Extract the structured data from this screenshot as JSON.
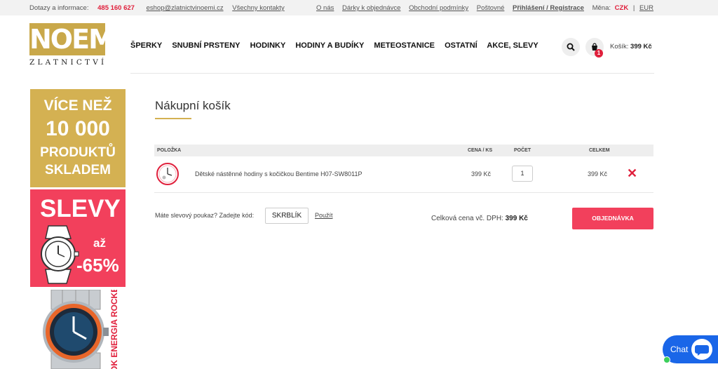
{
  "topbar": {
    "contact_label": "Dotazy a informace:",
    "phone": "485 160 627",
    "email": "eshop@zlatnictvinoemi.cz",
    "contacts_link": "Všechny kontakty",
    "links": [
      "O nás",
      "Dárky k objednávce",
      "Obchodní podmínky",
      "Poštovné"
    ],
    "login": "Přihlášení / Registrace",
    "currency_label": "Měna:",
    "currency_active": "CZK",
    "currency_sep": "|",
    "currency_other": "EUR"
  },
  "logo": {
    "mark": "NOEMI",
    "subtitle": "ZLATNICTVÍ"
  },
  "nav": [
    "ŠPERKY",
    "SNUBNÍ PRSTENY",
    "HODINKY",
    "HODINY A BUDÍKY",
    "METEOSTANICE",
    "OSTATNÍ",
    "AKCE, SLEVY"
  ],
  "cart": {
    "badge": "1",
    "label": "Košík:",
    "amount": "399 Kč"
  },
  "banners": {
    "b1": {
      "line1": "VÍCE NEŽ",
      "line2": "10 000",
      "line3": "PRODUKTŮ",
      "line4": "SKLADEM"
    },
    "b2": {
      "title": "SLEVY",
      "az": "až",
      "pct": "-65%"
    },
    "b3": {
      "vertical": "OK ENERGIA ROCKET"
    }
  },
  "page": {
    "title": "Nákupní košík"
  },
  "table": {
    "headers": {
      "item": "POLOŽKA",
      "price": "CENA / KS",
      "qty": "POČET",
      "total": "CELKEM"
    },
    "rows": [
      {
        "name": "Dětské nástěnné hodiny s kočičkou Bentime H07-SW8011P",
        "price": "399 Kč",
        "qty": "1",
        "total": "399 Kč",
        "remove": "✕"
      }
    ]
  },
  "coupon": {
    "label": "Máte slevový poukaz? Zadejte kód:",
    "value": "SKRBLÍK",
    "apply": "Použít"
  },
  "summary": {
    "label": "Celková cena vč. DPH:",
    "amount": "399 Kč"
  },
  "order_button": "OBJEDNÁVKA",
  "chat": {
    "label": "Chat"
  },
  "colors": {
    "accent_red": "#f2405c",
    "gold": "#d4b152",
    "chat_blue": "#1a66e8"
  },
  "icons": {
    "search": "search-icon",
    "cart": "cart-icon",
    "remove": "close-icon",
    "chat": "chat-bubble-icon"
  }
}
